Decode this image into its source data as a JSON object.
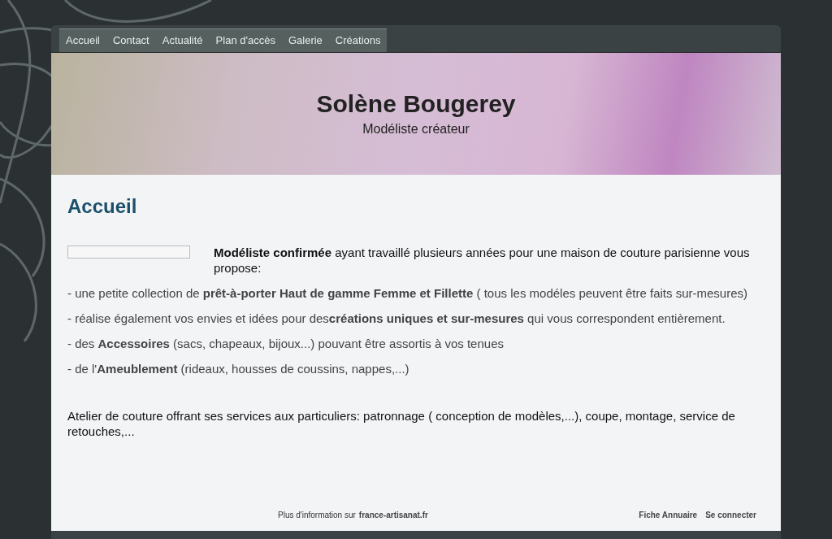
{
  "nav": {
    "items": [
      "Accueil",
      "Contact",
      "Actualité",
      "Plan d'accès",
      "Galerie",
      "Créations"
    ]
  },
  "header": {
    "title": "Solène Bougerey",
    "subtitle": "Modéliste créateur"
  },
  "content": {
    "heading": "Accueil",
    "intro": "**Modéliste confirmée** ayant travaillé plusieurs années pour une maison de couture parisienne vous propose:",
    "points": [
      "- une petite collection de **prêt-à-porter Haut de gamme Femme et Fillette** ( tous les modéles peuvent être faits sur-mesures)",
      "- réalise également vos envies et idées pour des**créations uniques et sur-mesures** qui vous correspondent entièrement.",
      "- des **Accessoires** (sacs, chapeaux, bijoux...) pouvant être assortis à vos tenues",
      "- de l'**Ameublement** (rideaux, housses de coussins, nappes,...)"
    ],
    "atelier": "Atelier de couture offrant ses services aux particuliers: patronnage ( conception de modèles,...), coupe, montage, service de retouches,..."
  },
  "footer": {
    "info_text": "Plus d'information sur",
    "info_link": "france-artisanat.fr",
    "links": [
      "Fiche Annuaire",
      "Se connecter"
    ]
  }
}
